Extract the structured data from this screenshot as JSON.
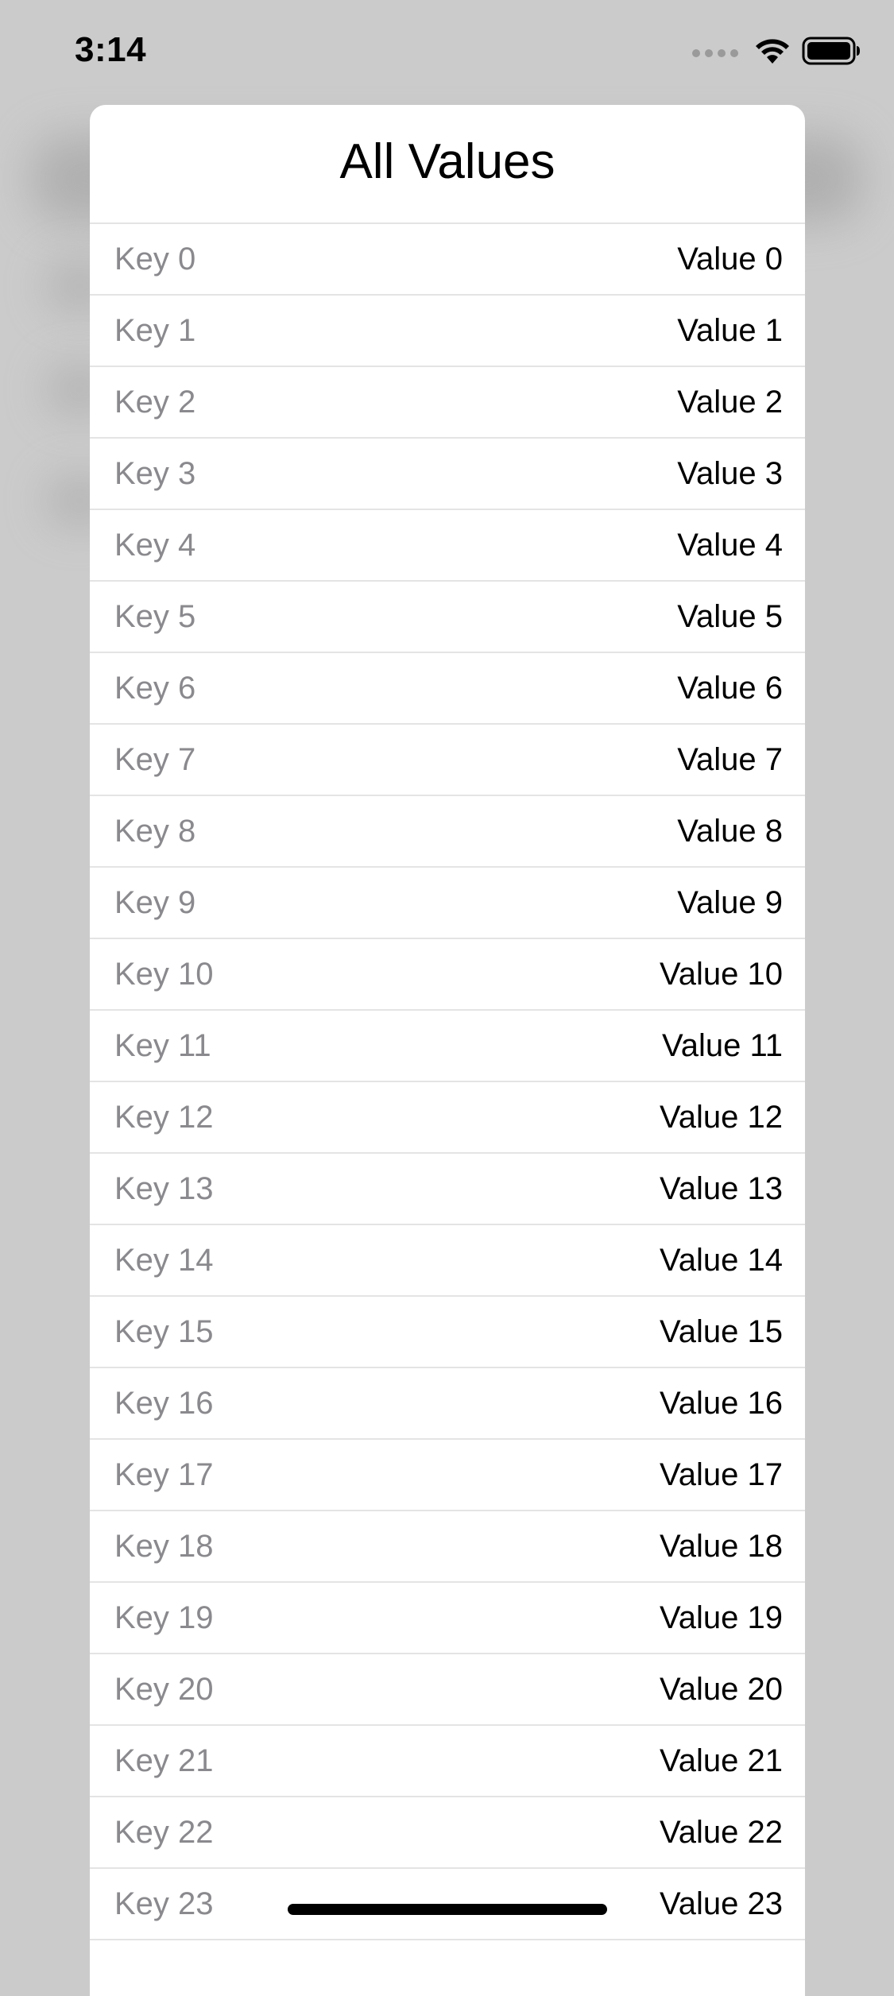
{
  "status_bar": {
    "time": "3:14",
    "icons": [
      "cellular-signal-icon",
      "wifi-icon",
      "battery-icon"
    ]
  },
  "sheet": {
    "title": "All Values",
    "rows": [
      {
        "key": "Key 0",
        "value": "Value 0"
      },
      {
        "key": "Key 1",
        "value": "Value 1"
      },
      {
        "key": "Key 2",
        "value": "Value 2"
      },
      {
        "key": "Key 3",
        "value": "Value 3"
      },
      {
        "key": "Key 4",
        "value": "Value 4"
      },
      {
        "key": "Key 5",
        "value": "Value 5"
      },
      {
        "key": "Key 6",
        "value": "Value 6"
      },
      {
        "key": "Key 7",
        "value": "Value 7"
      },
      {
        "key": "Key 8",
        "value": "Value 8"
      },
      {
        "key": "Key 9",
        "value": "Value 9"
      },
      {
        "key": "Key 10",
        "value": "Value 10"
      },
      {
        "key": "Key 11",
        "value": "Value 11"
      },
      {
        "key": "Key 12",
        "value": "Value 12"
      },
      {
        "key": "Key 13",
        "value": "Value 13"
      },
      {
        "key": "Key 14",
        "value": "Value 14"
      },
      {
        "key": "Key 15",
        "value": "Value 15"
      },
      {
        "key": "Key 16",
        "value": "Value 16"
      },
      {
        "key": "Key 17",
        "value": "Value 17"
      },
      {
        "key": "Key 18",
        "value": "Value 18"
      },
      {
        "key": "Key 19",
        "value": "Value 19"
      },
      {
        "key": "Key 20",
        "value": "Value 20"
      },
      {
        "key": "Key 21",
        "value": "Value 21"
      },
      {
        "key": "Key 22",
        "value": "Value 22"
      },
      {
        "key": "Key 23",
        "value": "Value 23"
      }
    ]
  },
  "colors": {
    "backdrop": "#cbcbcb",
    "sheet_background": "#ffffff",
    "key_text": "#8a8a8e",
    "value_text": "#000000",
    "separator": "#e4e4e4"
  }
}
